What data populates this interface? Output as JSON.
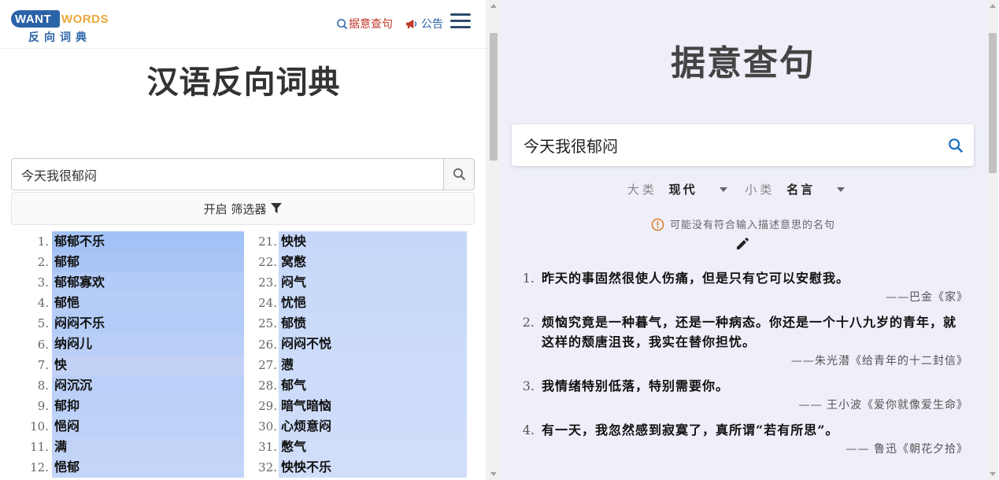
{
  "left": {
    "logo": {
      "want": "WANT",
      "words": "WORDS",
      "cn": "反向词典"
    },
    "nav": {
      "search_label": "据意查句",
      "announce_label": "公告"
    },
    "title": "汉语反向词典",
    "search": {
      "value": "今天我很郁闷"
    },
    "filter_label": "开启 筛选器",
    "results": [
      {
        "n": "1.",
        "w": "郁郁不乐",
        "c": "#a3c2f5"
      },
      {
        "n": "2.",
        "w": "郁郁",
        "c": "#a8c5f5"
      },
      {
        "n": "3.",
        "w": "郁郁寡欢",
        "c": "#b3cbf7"
      },
      {
        "n": "4.",
        "w": "郁悒",
        "c": "#b6cdf7"
      },
      {
        "n": "5.",
        "w": "闷闷不乐",
        "c": "#b4ccf8"
      },
      {
        "n": "6.",
        "w": "纳闷儿",
        "c": "#b9cff8"
      },
      {
        "n": "7.",
        "w": "怏",
        "c": "#c2d1f6"
      },
      {
        "n": "8.",
        "w": "闷沉沉",
        "c": "#bad0f8"
      },
      {
        "n": "9.",
        "w": "郁抑",
        "c": "#bcd1f8"
      },
      {
        "n": "10.",
        "w": "悒闷",
        "c": "#bed2f8"
      },
      {
        "n": "11.",
        "w": "满",
        "c": "#c1d4f8"
      },
      {
        "n": "12.",
        "w": "悒郁",
        "c": "#c3d5f8"
      },
      {
        "n": "21.",
        "w": "怏怏",
        "c": "#c6d7f9"
      },
      {
        "n": "22.",
        "w": "窝憋",
        "c": "#c7d8f9"
      },
      {
        "n": "23.",
        "w": "闷气",
        "c": "#c8d9f9"
      },
      {
        "n": "24.",
        "w": "忧悒",
        "c": "#c9d9f9"
      },
      {
        "n": "25.",
        "w": "郁愤",
        "c": "#cadaf9"
      },
      {
        "n": "26.",
        "w": "闷闷不悦",
        "c": "#cbdbf9"
      },
      {
        "n": "27.",
        "w": "懑",
        "c": "#ccdcfa"
      },
      {
        "n": "28.",
        "w": "郁气",
        "c": "#cddcfa"
      },
      {
        "n": "29.",
        "w": "暗气暗恼",
        "c": "#cedcfa"
      },
      {
        "n": "30.",
        "w": "心烦意闷",
        "c": "#cfddfa"
      },
      {
        "n": "31.",
        "w": "憋气",
        "c": "#d0defa"
      },
      {
        "n": "32.",
        "w": "怏怏不乐",
        "c": "#d1defa"
      }
    ]
  },
  "right": {
    "title": "据意查句",
    "search": {
      "value": "今天我很郁闷"
    },
    "category": {
      "label": "大类",
      "value": "现代"
    },
    "subcategory": {
      "label": "小类",
      "value": "名言"
    },
    "warning": "可能没有符合输入描述意思的名句",
    "quotes": [
      {
        "n": "1.",
        "text": "昨天的事固然很使人伤痛，但是只有它可以安慰我。",
        "src": "——巴金《家》"
      },
      {
        "n": "2.",
        "text": "烦恼究竟是一种暮气，还是一种病态。你还是一个十八九岁的青年，就这样的颓唐沮丧，我实在替你担忧。",
        "src": "——朱光潜《给青年的十二封信》"
      },
      {
        "n": "3.",
        "text": "我情绪特别低落，特别需要你。",
        "src": "—— 王小波《爱你就像爱生命》"
      },
      {
        "n": "4.",
        "text": "有一天，我忽然感到寂寞了，真所谓“若有所思”。",
        "src": "—— 鲁迅《朝花夕拾》"
      }
    ]
  },
  "colors": {
    "accent_blue": "#2b63a8",
    "nav_red": "#c0392b",
    "logo_orange": "#e9a83a",
    "right_bg": "#eeeff8",
    "search_icon_blue": "#1a6fc4",
    "warn_orange": "#e07b22"
  },
  "icons": [
    "search-icon",
    "megaphone-icon",
    "menu-icon",
    "filter-icon",
    "warning-icon",
    "pencil-icon",
    "caret-down-icon"
  ]
}
